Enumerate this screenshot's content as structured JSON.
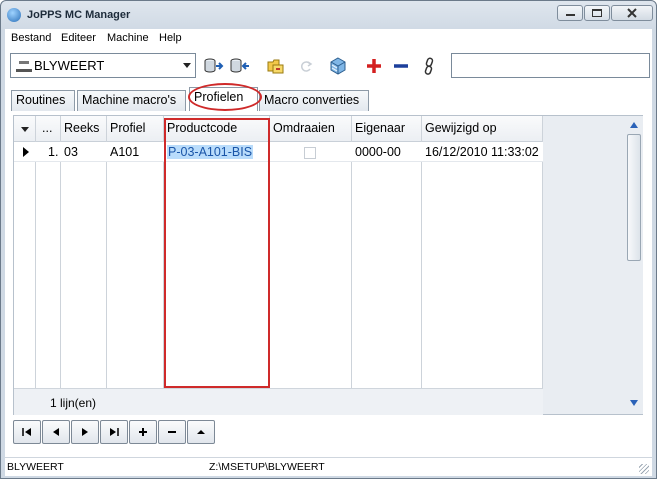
{
  "window": {
    "title": "JoPPS MC Manager",
    "icon": "jopps-app-icon"
  },
  "menubar": {
    "items": [
      "Bestand",
      "Editeer",
      "Machine",
      "Help"
    ]
  },
  "toolbar": {
    "location_select": "BLYWEERT",
    "buttons": [
      {
        "icon": "database-import-icon"
      },
      {
        "icon": "database-export-icon"
      },
      {
        "icon": "folder-sync-icon"
      },
      {
        "icon": "refresh-disabled-icon"
      },
      {
        "icon": "cube-icon"
      },
      {
        "icon": "add-icon"
      },
      {
        "icon": "remove-icon"
      },
      {
        "icon": "chain-icon"
      }
    ],
    "search_value": ""
  },
  "tabs": [
    {
      "label": "Routines",
      "active": false
    },
    {
      "label": "Machine macro's",
      "active": false
    },
    {
      "label": "Profielen",
      "active": true
    },
    {
      "label": "Macro converties",
      "active": false
    }
  ],
  "grid": {
    "columns": [
      "...",
      "Reeks",
      "Profiel",
      "Productcode",
      "Omdraaien",
      "Eigenaar",
      "Gewijzigd op"
    ],
    "rows": [
      {
        "no": "1.",
        "reeks": "03",
        "profiel": "A101",
        "productcode": "P-03-A101-BIS",
        "omdraaien": false,
        "eigenaar": "0000-00",
        "gewijzigd_op": "16/12/2010 11:33:02"
      }
    ],
    "footer": "1 lijn(en)"
  },
  "navigator": {
    "buttons": [
      {
        "icon": "first-record-icon"
      },
      {
        "icon": "prior-record-icon"
      },
      {
        "icon": "next-record-icon"
      },
      {
        "icon": "last-record-icon"
      },
      {
        "icon": "insert-record-icon"
      },
      {
        "icon": "delete-record-icon"
      },
      {
        "icon": "edit-record-icon"
      }
    ]
  },
  "statusbar": {
    "location": "BLYWEERT",
    "path": "Z:\\MSETUP\\BLYWEERT"
  },
  "colors": {
    "annotation_red": "#cf2a2a",
    "selection_blue": "#b9dcfb",
    "accent_blue": "#2b62b8"
  }
}
